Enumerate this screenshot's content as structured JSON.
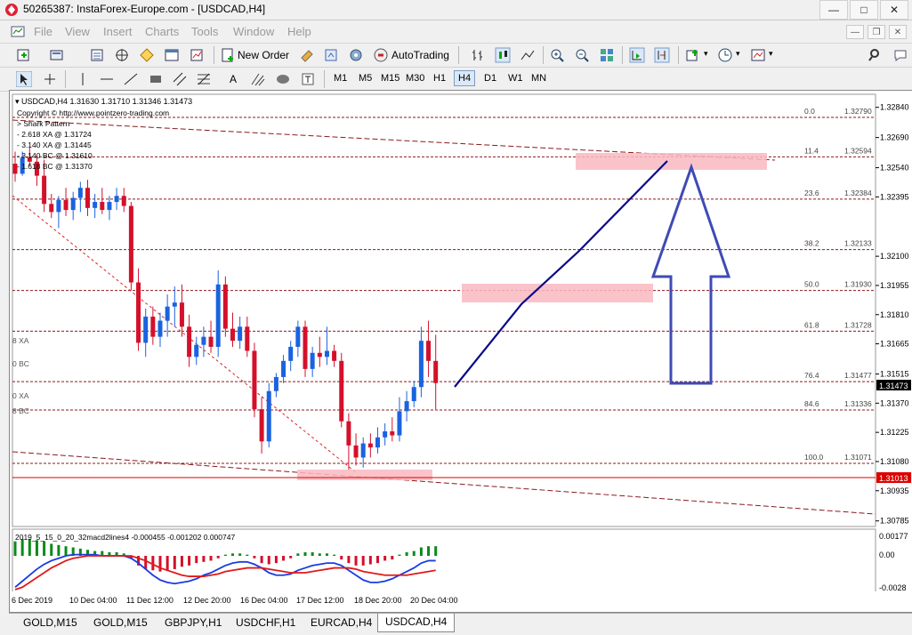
{
  "window": {
    "title": "50265387: InstaForex-Europe.com - [USDCAD,H4]"
  },
  "menu": [
    "File",
    "View",
    "Insert",
    "Charts",
    "Tools",
    "Window",
    "Help"
  ],
  "toolbar": {
    "new_order": "New Order",
    "auto_trading": "AutoTrading"
  },
  "timeframes": [
    "M1",
    "M5",
    "M15",
    "M30",
    "H1",
    "H4",
    "D1",
    "W1",
    "MN"
  ],
  "active_timeframe": "H4",
  "chart_header": {
    "symbol_line": "USDCAD,H4  1.31630 1.31710 1.31346 1.31473",
    "lines": [
      "Copyright © http://www.pointzero-trading.com",
      "> Shark Pattern",
      "- 2.618 XA @ 1.31724",
      "- 3.140 XA @ 1.31445",
      "- 3.140 BC @ 1.31610",
      "- 1.618 BC @ 1.31370"
    ]
  },
  "side_labels": [
    "8 XA",
    "0 BC",
    "0 XA",
    "8 BC"
  ],
  "fib_levels": [
    {
      "ratio": "0.0",
      "price": "1.32790"
    },
    {
      "ratio": "11.4",
      "price": "1.32594"
    },
    {
      "ratio": "23.6",
      "price": "1.32384"
    },
    {
      "ratio": "38.2",
      "price": "1.32133"
    },
    {
      "ratio": "50.0",
      "price": "1.31930"
    },
    {
      "ratio": "61.8",
      "price": "1.31728"
    },
    {
      "ratio": "76.4",
      "price": "1.31477"
    },
    {
      "ratio": "84.6",
      "price": "1.31336"
    },
    {
      "ratio": "100.0",
      "price": "1.31071"
    }
  ],
  "price_axis": [
    "1.32840",
    "1.32690",
    "1.32540",
    "1.32395",
    "1.32100",
    "1.31955",
    "1.31810",
    "1.31665",
    "1.31515",
    "1.31370",
    "1.31225",
    "1.31080",
    "1.30935",
    "1.30785"
  ],
  "current_price": "1.31473",
  "support_price": "1.31013",
  "indicator": {
    "label": "2019_5_15_0_20_32macd2lines4 -0.000455 -0.001202 0.000747",
    "axis": [
      "0.00177",
      "0.00",
      "-0.0028"
    ]
  },
  "time_axis": [
    "6 Dec 2019",
    "10 Dec 04:00",
    "11 Dec 12:00",
    "12 Dec 20:00",
    "16 Dec 04:00",
    "17 Dec 12:00",
    "18 Dec 20:00",
    "20 Dec 04:00"
  ],
  "tabs": [
    "GOLD,M15",
    "GOLD,M15",
    "GBPJPY,H1",
    "USDCHF,H1",
    "EURCAD,H4",
    "USDCAD,H4"
  ],
  "active_tab": "USDCAD,H4",
  "candles": [
    [
      1.3256,
      1.3262,
      1.3247,
      1.3251
    ],
    [
      1.3251,
      1.3262,
      1.325,
      1.3259
    ],
    [
      1.3259,
      1.3264,
      1.3255,
      1.3257
    ],
    [
      1.3257,
      1.326,
      1.3245,
      1.325
    ],
    [
      1.325,
      1.3258,
      1.3232,
      1.3236
    ],
    [
      1.3236,
      1.3241,
      1.3229,
      1.3232
    ],
    [
      1.3232,
      1.324,
      1.3224,
      1.3238
    ],
    [
      1.3238,
      1.3244,
      1.323,
      1.3233
    ],
    [
      1.3233,
      1.3242,
      1.3228,
      1.3239
    ],
    [
      1.3239,
      1.3247,
      1.3232,
      1.3244
    ],
    [
      1.3244,
      1.3248,
      1.323,
      1.3234
    ],
    [
      1.3234,
      1.3241,
      1.3229,
      1.3237
    ],
    [
      1.3237,
      1.3244,
      1.3231,
      1.3233
    ],
    [
      1.3233,
      1.324,
      1.3228,
      1.3237
    ],
    [
      1.3237,
      1.3244,
      1.3233,
      1.324
    ],
    [
      1.324,
      1.3244,
      1.3232,
      1.3235
    ],
    [
      1.3235,
      1.3237,
      1.3193,
      1.3197
    ],
    [
      1.3197,
      1.3204,
      1.3163,
      1.3167
    ],
    [
      1.3167,
      1.3184,
      1.316,
      1.318
    ],
    [
      1.318,
      1.3185,
      1.3166,
      1.317
    ],
    [
      1.317,
      1.3182,
      1.3165,
      1.3178
    ],
    [
      1.3178,
      1.3191,
      1.317,
      1.3185
    ],
    [
      1.3185,
      1.3195,
      1.3175,
      1.3187
    ],
    [
      1.3187,
      1.3196,
      1.317,
      1.3175
    ],
    [
      1.3175,
      1.3181,
      1.3155,
      1.316
    ],
    [
      1.316,
      1.317,
      1.3156,
      1.3166
    ],
    [
      1.3166,
      1.3175,
      1.316,
      1.317
    ],
    [
      1.317,
      1.3178,
      1.3162,
      1.3165
    ],
    [
      1.3165,
      1.3203,
      1.316,
      1.3196
    ],
    [
      1.3196,
      1.32,
      1.317,
      1.3174
    ],
    [
      1.3174,
      1.3182,
      1.3165,
      1.3168
    ],
    [
      1.3168,
      1.318,
      1.3164,
      1.3175
    ],
    [
      1.3175,
      1.318,
      1.316,
      1.3163
    ],
    [
      1.3163,
      1.3167,
      1.313,
      1.3134
    ],
    [
      1.3134,
      1.314,
      1.3112,
      1.3118
    ],
    [
      1.3118,
      1.3147,
      1.3115,
      1.3143
    ],
    [
      1.3143,
      1.3152,
      1.314,
      1.315
    ],
    [
      1.315,
      1.3161,
      1.3147,
      1.3158
    ],
    [
      1.3158,
      1.3168,
      1.3153,
      1.3165
    ],
    [
      1.3165,
      1.3178,
      1.316,
      1.3175
    ],
    [
      1.3175,
      1.3178,
      1.315,
      1.3154
    ],
    [
      1.3154,
      1.3165,
      1.315,
      1.3162
    ],
    [
      1.3162,
      1.317,
      1.3155,
      1.316
    ],
    [
      1.316,
      1.3175,
      1.3156,
      1.3163
    ],
    [
      1.3163,
      1.3166,
      1.3155,
      1.3158
    ],
    [
      1.3158,
      1.3162,
      1.3125,
      1.3128
    ],
    [
      1.3128,
      1.3132,
      1.3104,
      1.3116
    ],
    [
      1.3116,
      1.3122,
      1.3106,
      1.311
    ],
    [
      1.311,
      1.312,
      1.3105,
      1.3117
    ],
    [
      1.3117,
      1.3122,
      1.311,
      1.3115
    ],
    [
      1.3115,
      1.3125,
      1.3112,
      1.312
    ],
    [
      1.312,
      1.3127,
      1.3116,
      1.3123
    ],
    [
      1.3123,
      1.313,
      1.3118,
      1.3121
    ],
    [
      1.3121,
      1.314,
      1.3118,
      1.3133
    ],
    [
      1.3133,
      1.3143,
      1.3128,
      1.3138
    ],
    [
      1.3138,
      1.3148,
      1.3135,
      1.3145
    ],
    [
      1.3145,
      1.3175,
      1.314,
      1.3168
    ],
    [
      1.3168,
      1.3178,
      1.315,
      1.3158
    ],
    [
      1.3158,
      1.3171,
      1.3134,
      1.3147
    ]
  ],
  "macd_bars": [
    0.0012,
    0.0014,
    0.0014,
    0.0013,
    0.0012,
    0.001,
    0.0009,
    0.0008,
    0.0007,
    0.0006,
    0.0005,
    0.0004,
    0.0004,
    0.0003,
    0.0003,
    0.0002,
    -0.0002,
    -0.0008,
    -0.0011,
    -0.0012,
    -0.0013,
    -0.0012,
    -0.0011,
    -0.0009,
    -0.0008,
    -0.0006,
    -0.0005,
    -0.0004,
    -0.0002,
    0.0001,
    0.0002,
    0.0002,
    0.0001,
    -0.0002,
    -0.0006,
    -0.0007,
    -0.0006,
    -0.0004,
    -0.0002,
    0.0002,
    0.0003,
    0.0003,
    0.0002,
    0.0002,
    0.0001,
    -0.0003,
    -0.0006,
    -0.0008,
    -0.0008,
    -0.0007,
    -0.0006,
    -0.0004,
    -0.0003,
    0.0001,
    0.0003,
    0.0004,
    0.0007,
    0.0008,
    0.0008
  ],
  "macd_line": [
    -0.0026,
    -0.0021,
    -0.0016,
    -0.0011,
    -0.0007,
    -0.0004,
    -0.0002,
    0.0,
    0.0001,
    0.0001,
    0.0001,
    0.0001,
    0.0,
    0.0,
    0.0,
    0.0,
    -0.0002,
    -0.0006,
    -0.0011,
    -0.0016,
    -0.002,
    -0.0022,
    -0.0023,
    -0.0022,
    -0.0021,
    -0.0019,
    -0.0016,
    -0.0014,
    -0.0011,
    -0.0008,
    -0.0006,
    -0.0005,
    -0.0005,
    -0.0007,
    -0.001,
    -0.0014,
    -0.0016,
    -0.0016,
    -0.0015,
    -0.0012,
    -0.001,
    -0.0008,
    -0.0007,
    -0.0006,
    -0.0006,
    -0.0008,
    -0.0012,
    -0.0016,
    -0.002,
    -0.0022,
    -0.0022,
    -0.0021,
    -0.0019,
    -0.0016,
    -0.0013,
    -0.001,
    -0.0006,
    -0.0004,
    -0.0004
  ],
  "signal_line": [
    -0.0028,
    -0.0026,
    -0.0022,
    -0.0018,
    -0.0014,
    -0.001,
    -0.0007,
    -0.0004,
    -0.0002,
    -0.0001,
    0.0,
    0.0,
    0.0,
    0.0,
    0.0,
    0.0,
    0.0,
    -0.0002,
    -0.0004,
    -0.0007,
    -0.001,
    -0.0012,
    -0.0014,
    -0.0016,
    -0.0017,
    -0.0017,
    -0.0017,
    -0.0016,
    -0.0015,
    -0.0013,
    -0.0012,
    -0.0011,
    -0.001,
    -0.001,
    -0.001,
    -0.0011,
    -0.0012,
    -0.0013,
    -0.0014,
    -0.0014,
    -0.0014,
    -0.0013,
    -0.0012,
    -0.0011,
    -0.001,
    -0.001,
    -0.001,
    -0.0011,
    -0.0013,
    -0.0014,
    -0.0015,
    -0.0016,
    -0.0016,
    -0.0016,
    -0.0016,
    -0.0015,
    -0.0014,
    -0.0013,
    -0.0012
  ]
}
